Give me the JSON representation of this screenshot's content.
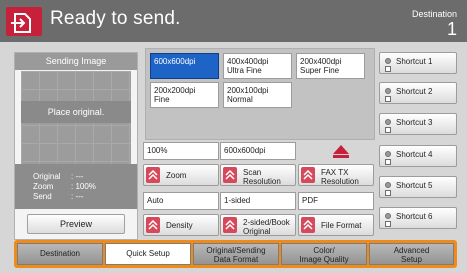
{
  "header": {
    "status": "Ready to send.",
    "destination_label": "Destination",
    "destination_count": "1",
    "logo_icon": "send-document-icon"
  },
  "left_panel": {
    "title": "Sending Image",
    "placeholder": "Place original.",
    "info": [
      {
        "key": "Original",
        "value": ":  ---"
      },
      {
        "key": "Zoom",
        "value": ":  100%"
      },
      {
        "key": "Send",
        "value": ":  ---"
      }
    ],
    "preview_button": "Preview"
  },
  "resolution": {
    "options": [
      {
        "label": "600x600dpi",
        "selected": true
      },
      {
        "label": "400x400dpi\nUltra Fine",
        "selected": false
      },
      {
        "label": "200x400dpi\nSuper Fine",
        "selected": false
      },
      {
        "label": "200x200dpi\nFine",
        "selected": false
      },
      {
        "label": "200x100dpi\nNormal",
        "selected": false
      }
    ]
  },
  "settings": [
    {
      "value": "100%",
      "button": "Zoom"
    },
    {
      "value": "600x600dpi",
      "button": "Scan\nResolution"
    },
    {
      "value": "",
      "button": "FAX TX\nResolution"
    },
    {
      "value": "Auto",
      "button": "Density"
    },
    {
      "value": "1-sided",
      "button": "2-sided/Book\nOriginal"
    },
    {
      "value": "PDF",
      "button": "File Format"
    }
  ],
  "shortcuts": [
    "Shortcut 1",
    "Shortcut 2",
    "Shortcut 3",
    "Shortcut 4",
    "Shortcut 5",
    "Shortcut 6"
  ],
  "tabs": [
    {
      "label": "Destination",
      "active": false
    },
    {
      "label": "Quick Setup",
      "active": true
    },
    {
      "label": "Original/Sending\nData Format",
      "active": false
    },
    {
      "label": "Color/\nImage Quality",
      "active": false
    },
    {
      "label": "Advanced\nSetup",
      "active": false
    }
  ],
  "colors": {
    "accent": "#c6203a",
    "selected": "#1e63c6",
    "tab_highlight": "#f08a1a"
  }
}
